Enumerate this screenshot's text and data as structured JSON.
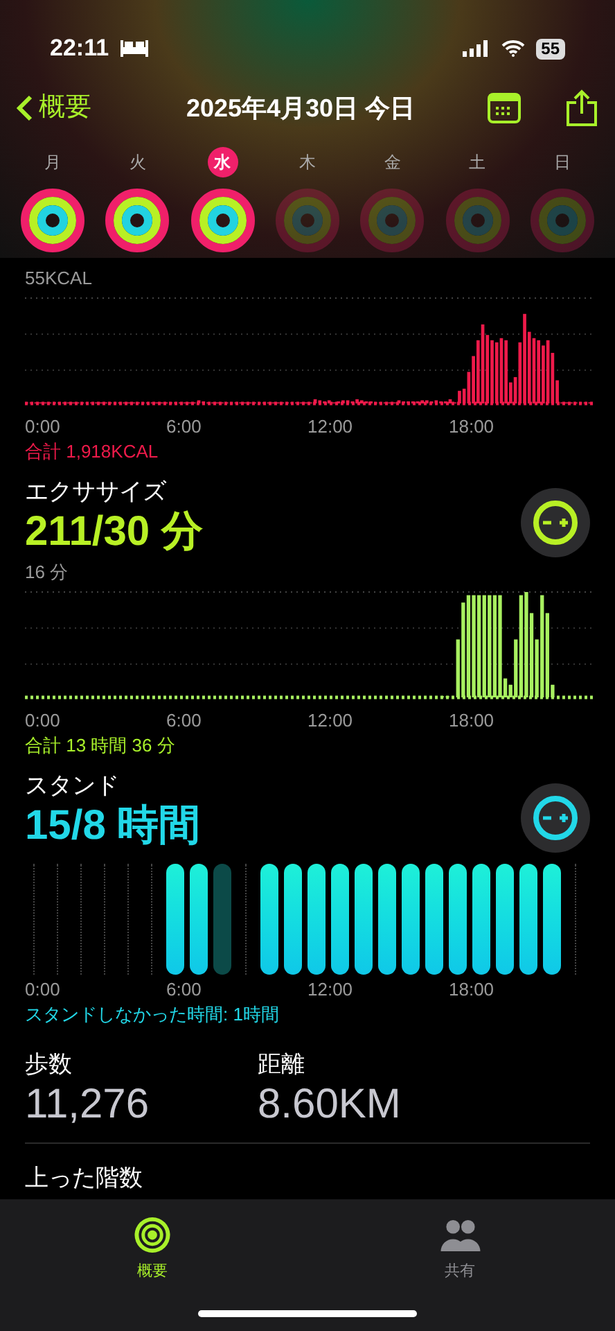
{
  "status_bar": {
    "time": "22:11",
    "battery": "55"
  },
  "nav": {
    "back": "概要",
    "title": "2025年4月30日 今日"
  },
  "days": [
    {
      "label": "月",
      "selected": false,
      "filled": true
    },
    {
      "label": "火",
      "selected": false,
      "filled": true
    },
    {
      "label": "水",
      "selected": true,
      "filled": true
    },
    {
      "label": "木",
      "selected": false,
      "filled": false
    },
    {
      "label": "金",
      "selected": false,
      "filled": false
    },
    {
      "label": "土",
      "selected": false,
      "filled": false
    },
    {
      "label": "日",
      "selected": false,
      "filled": false
    }
  ],
  "move": {
    "max_label": "55KCAL",
    "x_labels": [
      "0:00",
      "6:00",
      "12:00",
      "18:00"
    ],
    "total": "合計 1,918KCAL"
  },
  "exercise": {
    "title": "エクササイズ",
    "value": "211/30 分",
    "max_label": "16 分",
    "x_labels": [
      "0:00",
      "6:00",
      "12:00",
      "18:00"
    ],
    "total": "合計 13 時間 36 分"
  },
  "stand": {
    "title": "スタンド",
    "value": "15/8 時間",
    "x_labels": [
      "0:00",
      "6:00",
      "12:00",
      "18:00"
    ],
    "total": "スタンドしなかった時間: 1時間",
    "hours": [
      {
        "kind": "empty"
      },
      {
        "kind": "empty"
      },
      {
        "kind": "empty"
      },
      {
        "kind": "empty"
      },
      {
        "kind": "empty"
      },
      {
        "kind": "empty"
      },
      {
        "kind": "stood"
      },
      {
        "kind": "stood"
      },
      {
        "kind": "missed"
      },
      {
        "kind": "empty"
      },
      {
        "kind": "stood"
      },
      {
        "kind": "stood"
      },
      {
        "kind": "stood"
      },
      {
        "kind": "stood"
      },
      {
        "kind": "stood"
      },
      {
        "kind": "stood"
      },
      {
        "kind": "stood"
      },
      {
        "kind": "stood"
      },
      {
        "kind": "stood"
      },
      {
        "kind": "stood"
      },
      {
        "kind": "stood"
      },
      {
        "kind": "stood"
      },
      {
        "kind": "stood"
      },
      {
        "kind": "empty"
      }
    ]
  },
  "stats": [
    {
      "label": "歩数",
      "value": "11,276"
    },
    {
      "label": "距離",
      "value": "8.60KM"
    }
  ],
  "floors": {
    "label": "上った階数"
  },
  "tab_bar": [
    {
      "label": "概要",
      "selected": true
    },
    {
      "label": "共有",
      "selected": false
    }
  ]
}
